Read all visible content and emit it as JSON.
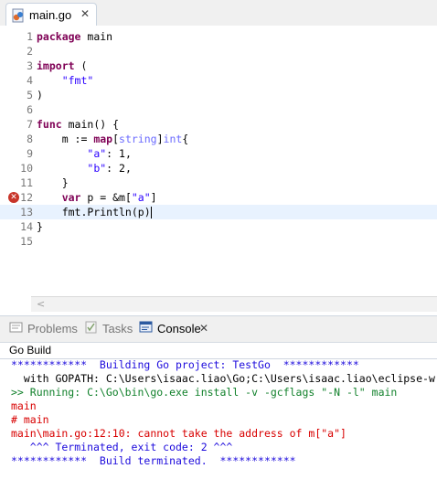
{
  "editor_tab": {
    "label": "main.go",
    "icon": "go-file-icon"
  },
  "code_lines": [
    {
      "n": "1",
      "tokens": [
        [
          "kw",
          "package"
        ],
        [
          "plain",
          " main"
        ]
      ]
    },
    {
      "n": "2",
      "tokens": []
    },
    {
      "n": "3",
      "tokens": [
        [
          "kw",
          "import"
        ],
        [
          "plain",
          " ("
        ]
      ]
    },
    {
      "n": "4",
      "tokens": [
        [
          "plain",
          "    "
        ],
        [
          "str",
          "\"fmt\""
        ]
      ]
    },
    {
      "n": "5",
      "tokens": [
        [
          "plain",
          ")"
        ]
      ]
    },
    {
      "n": "6",
      "tokens": []
    },
    {
      "n": "7",
      "tokens": [
        [
          "kw",
          "func"
        ],
        [
          "plain",
          " main() {"
        ]
      ]
    },
    {
      "n": "8",
      "tokens": [
        [
          "plain",
          "    m := "
        ],
        [
          "bi",
          "map"
        ],
        [
          "plain",
          "["
        ],
        [
          "typ",
          "string"
        ],
        [
          "plain",
          "]"
        ],
        [
          "typ",
          "int"
        ],
        [
          "plain",
          "{"
        ]
      ]
    },
    {
      "n": "9",
      "tokens": [
        [
          "plain",
          "        "
        ],
        [
          "str",
          "\"a\""
        ],
        [
          "plain",
          ": 1,"
        ]
      ]
    },
    {
      "n": "10",
      "tokens": [
        [
          "plain",
          "        "
        ],
        [
          "str",
          "\"b\""
        ],
        [
          "plain",
          ": 2,"
        ]
      ]
    },
    {
      "n": "11",
      "tokens": [
        [
          "plain",
          "    }"
        ]
      ]
    },
    {
      "n": "12",
      "tokens": [
        [
          "plain",
          "    "
        ],
        [
          "kw",
          "var"
        ],
        [
          "plain",
          " p = &m["
        ],
        [
          "str",
          "\"a\""
        ],
        [
          "plain",
          "]"
        ]
      ],
      "error": true
    },
    {
      "n": "13",
      "tokens": [
        [
          "plain",
          "    fmt.Println(p)"
        ]
      ],
      "current": true
    },
    {
      "n": "14",
      "tokens": [
        [
          "plain",
          "}"
        ]
      ]
    },
    {
      "n": "15",
      "tokens": []
    }
  ],
  "panel": {
    "tabs": [
      {
        "label": "Problems",
        "icon": "problems-icon"
      },
      {
        "label": "Tasks",
        "icon": "tasks-icon"
      },
      {
        "label": "Console",
        "icon": "console-icon",
        "active": true
      }
    ],
    "console_title": "Go Build"
  },
  "console_lines": [
    {
      "text": "************  Building Go project: TestGo  ************",
      "color": "blue"
    },
    {
      "text": "  with GOPATH: C:\\Users\\isaac.liao\\Go;C:\\Users\\isaac.liao\\eclipse-w",
      "color": "black"
    },
    {
      "text": ">> Running: C:\\Go\\bin\\go.exe install -v -gcflags \"-N -l\" main",
      "color": "green"
    },
    {
      "text": "main",
      "color": "red"
    },
    {
      "text": "# main",
      "color": "red"
    },
    {
      "text": "main\\main.go:12:10: cannot take the address of m[\"a\"]",
      "color": "red"
    },
    {
      "text": "   ^^^ Terminated, exit code: 2 ^^^",
      "color": "blue"
    },
    {
      "text": "************  Build terminated.  ************",
      "color": "blue"
    }
  ],
  "colors": {
    "keyword": "#7f0055",
    "string": "#2a00ff",
    "type": "#6b6bff",
    "error": "#d80000",
    "current_line": "#e8f2fe",
    "console_blue": "#1d0bdc",
    "console_green": "#11812b"
  }
}
